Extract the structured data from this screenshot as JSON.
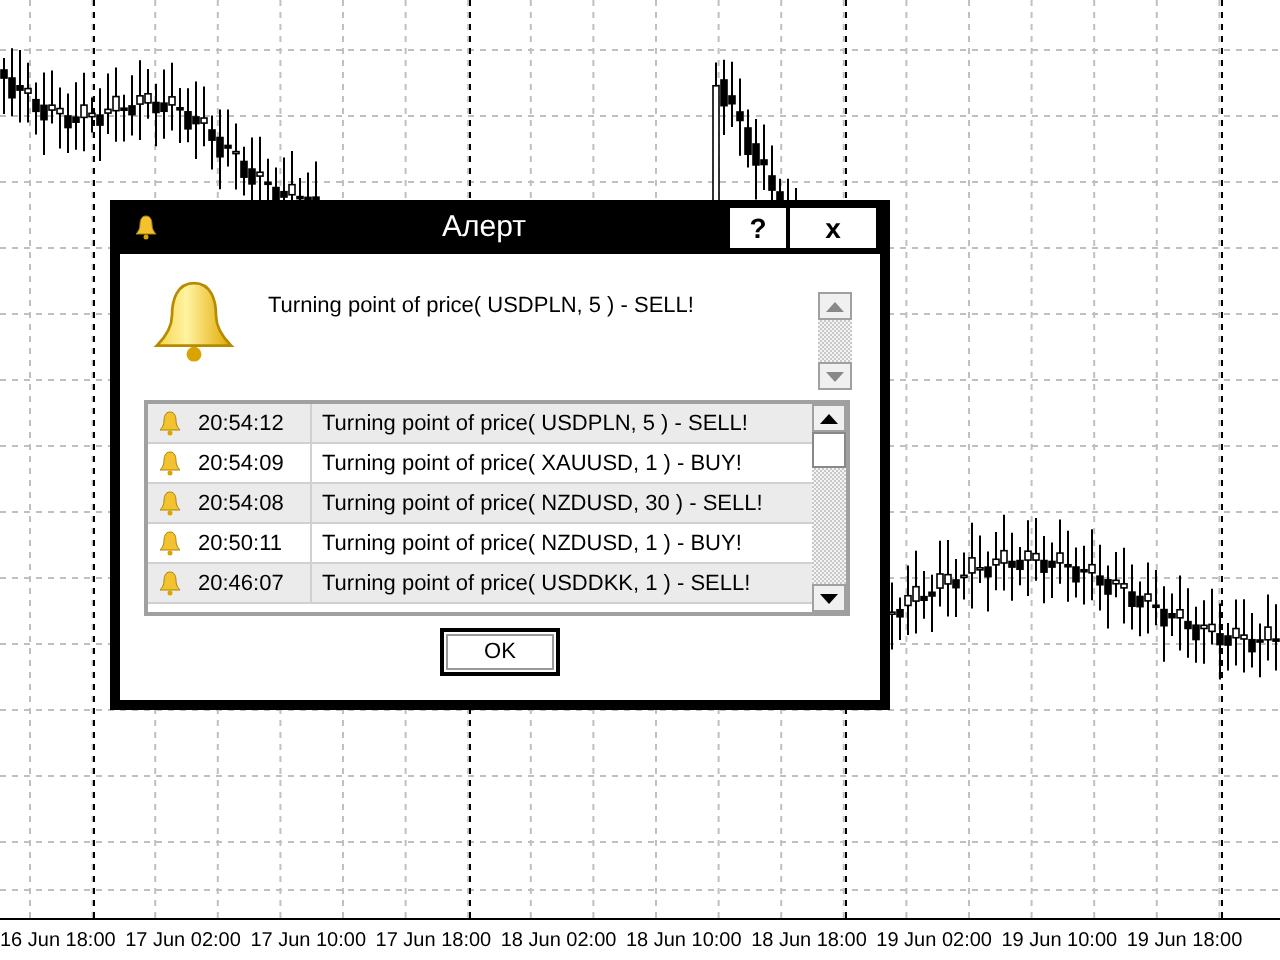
{
  "chart": {
    "time_labels": [
      "16 Jun 18:00",
      "17 Jun 02:00",
      "17 Jun 10:00",
      "17 Jun 18:00",
      "18 Jun 02:00",
      "18 Jun 10:00",
      "18 Jun 18:00",
      "19 Jun 02:00",
      "19 Jun 10:00",
      "19 Jun 18:00"
    ]
  },
  "dialog": {
    "title": "Алерт",
    "help_button": "?",
    "close_button": "x",
    "message": "Turning point of price( USDPLN, 5 ) - SELL!",
    "alerts": [
      {
        "time": "20:54:12",
        "text": "Turning point of price( USDPLN, 5 ) - SELL!"
      },
      {
        "time": "20:54:09",
        "text": "Turning point of price( XAUUSD, 1 ) - BUY!"
      },
      {
        "time": "20:54:08",
        "text": "Turning point of price( NZDUSD, 30 ) - SELL!"
      },
      {
        "time": "20:50:11",
        "text": "Turning point of price( NZDUSD, 1 ) - BUY!"
      },
      {
        "time": "20:46:07",
        "text": "Turning point of price( USDDKK, 1 ) - SELL!"
      }
    ],
    "ok_button": "OK"
  }
}
